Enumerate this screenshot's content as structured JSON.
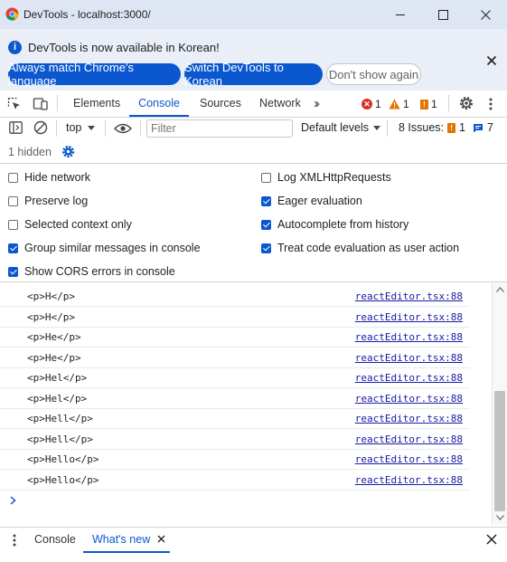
{
  "window": {
    "title": "DevTools - localhost:3000/"
  },
  "infobar": {
    "message": "DevTools is now available in Korean!",
    "btn_match": "Always match Chrome's language",
    "btn_switch": "Switch DevTools to Korean",
    "btn_dismiss": "Don't show again"
  },
  "tabs": {
    "elements": "Elements",
    "console": "Console",
    "sources": "Sources",
    "network": "Network"
  },
  "badges": {
    "errors": "1",
    "warnings": "1",
    "issues": "1"
  },
  "toolbar": {
    "context": "top",
    "filter_placeholder": "Filter",
    "levels": "Default levels",
    "issues_label": "8 Issues:",
    "issues_warn": "1",
    "issues_info": "7",
    "hidden": "1 hidden"
  },
  "settings": {
    "hide_network": "Hide network",
    "log_xhr": "Log XMLHttpRequests",
    "preserve_log": "Preserve log",
    "eager_eval": "Eager evaluation",
    "selected_context": "Selected context only",
    "autocomplete": "Autocomplete from history",
    "group_similar": "Group similar messages in console",
    "treat_eval": "Treat code evaluation as user action",
    "show_cors": "Show CORS errors in console"
  },
  "log": [
    {
      "msg": "<p>H</p>",
      "src": "reactEditor.tsx:88"
    },
    {
      "msg": "<p>H</p>",
      "src": "reactEditor.tsx:88"
    },
    {
      "msg": "<p>He</p>",
      "src": "reactEditor.tsx:88"
    },
    {
      "msg": "<p>He</p>",
      "src": "reactEditor.tsx:88"
    },
    {
      "msg": "<p>Hel</p>",
      "src": "reactEditor.tsx:88"
    },
    {
      "msg": "<p>Hel</p>",
      "src": "reactEditor.tsx:88"
    },
    {
      "msg": "<p>Hell</p>",
      "src": "reactEditor.tsx:88"
    },
    {
      "msg": "<p>Hell</p>",
      "src": "reactEditor.tsx:88"
    },
    {
      "msg": "<p>Hello</p>",
      "src": "reactEditor.tsx:88"
    },
    {
      "msg": "<p>Hello</p>",
      "src": "reactEditor.tsx:88"
    }
  ],
  "drawer": {
    "console": "Console",
    "whats_new": "What's new"
  },
  "colors": {
    "accent": "#0b57d0",
    "error": "#d93025",
    "warning": "#e37400"
  }
}
